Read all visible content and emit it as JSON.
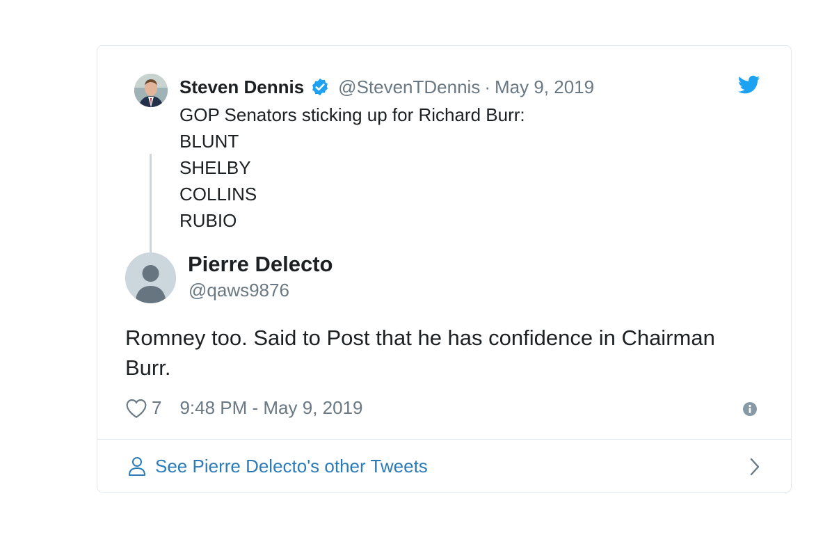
{
  "parent_tweet": {
    "author_name": "Steven Dennis",
    "author_handle": "@StevenTDennis",
    "separator": "·",
    "date": "May 9, 2019",
    "lines": [
      "GOP Senators sticking up for Richard Burr:",
      "BLUNT",
      "SHELBY",
      "COLLINS",
      "RUBIO"
    ]
  },
  "reply_tweet": {
    "author_name": "Pierre Delecto",
    "author_handle": "@qaws9876",
    "text": "Romney too. Said to Post that he has confidence in Chairman Burr.",
    "like_count": "7",
    "timestamp": "9:48 PM - May 9, 2019"
  },
  "footer": {
    "label": "See Pierre Delecto's other Tweets"
  },
  "icons": {
    "brand": "twitter-bird-icon",
    "verified": "verified-badge-icon",
    "like": "heart-icon",
    "info": "info-icon",
    "profile": "person-icon",
    "chevron": "chevron-right-icon"
  },
  "colors": {
    "twitter_blue": "#1da1f2",
    "link_blue": "#2b7bb9",
    "secondary_text": "#697882",
    "border": "#e1e8ed"
  }
}
